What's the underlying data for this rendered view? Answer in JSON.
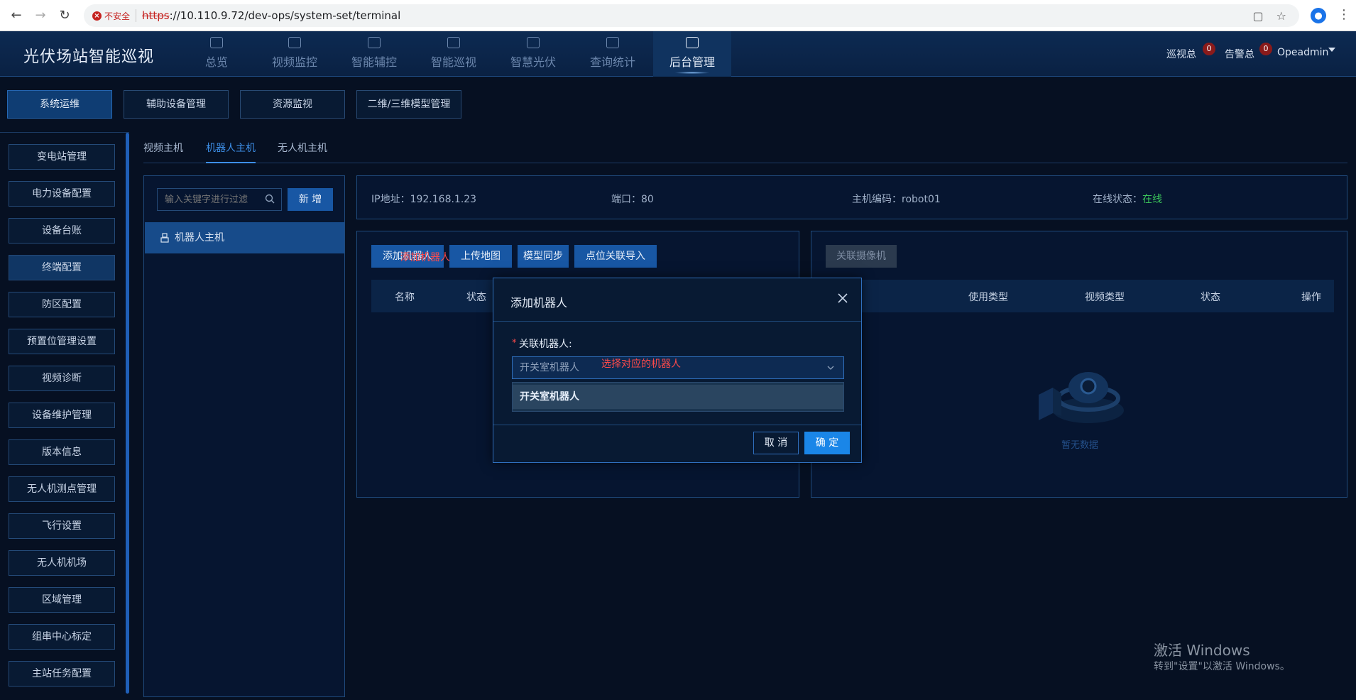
{
  "browser": {
    "insecure_label": "不安全",
    "url_scheme": "https",
    "url_rest": "://10.110.9.72/dev-ops/system-set/terminal"
  },
  "header": {
    "app_title": "光伏场站智能巡视",
    "nav": [
      {
        "label": "总览",
        "icon": "home-icon"
      },
      {
        "label": "视频监控",
        "icon": "video-icon"
      },
      {
        "label": "智能辅控",
        "icon": "document-icon"
      },
      {
        "label": "智能巡视",
        "icon": "monitor-icon"
      },
      {
        "label": "智慧光伏",
        "icon": "user-icon"
      },
      {
        "label": "查询统计",
        "icon": "report-icon"
      },
      {
        "label": "后台管理",
        "icon": "book-icon"
      }
    ],
    "patrol_label": "巡视总",
    "patrol_count": "0",
    "alarm_label": "告警总",
    "alarm_count": "0",
    "user": "Opeadmin"
  },
  "subtabs": [
    "系统运维",
    "辅助设备管理",
    "资源监视",
    "二维/三维模型管理"
  ],
  "menu": [
    "变电站管理",
    "电力设备配置",
    "设备台账",
    "终端配置",
    "防区配置",
    "预置位管理设置",
    "视频诊断",
    "设备维护管理",
    "版本信息",
    "无人机测点管理",
    "飞行设置",
    "无人机机场",
    "区域管理",
    "组串中心标定",
    "主站任务配置"
  ],
  "content_tabs": [
    "视频主机",
    "机器人主机",
    "无人机主机"
  ],
  "host_panel": {
    "search_placeholder": "输入关键字进行过滤",
    "add_label": "新 增",
    "host_item": "机器人主机"
  },
  "info": {
    "ip_label": "IP地址：",
    "ip_value": "192.168.1.23",
    "port_label": "端口：",
    "port_value": "80",
    "code_label": "主机编码：",
    "code_value": "robot01",
    "status_label": "在线状态：",
    "status_value": "在线"
  },
  "robot_panel": {
    "buttons": [
      "添加机器人",
      "上传地图",
      "模型同步",
      "点位关联导入"
    ],
    "annotation": "添加机器人",
    "columns": [
      "名称",
      "状态"
    ]
  },
  "cam_panel": {
    "button": "关联摄像机",
    "columns": [
      "使用类型",
      "视频类型",
      "状态",
      "操作"
    ],
    "empty_text": "暂无数据"
  },
  "modal": {
    "title": "添加机器人",
    "field_label": "关联机器人:",
    "select_value": "开关室机器人",
    "annotation": "选择对应的机器人",
    "option": "开关室机器人",
    "cancel": "取 消",
    "ok": "确 定"
  },
  "watermark": {
    "title": "激活 Windows",
    "subtitle": "转到\"设置\"以激活 Windows。"
  }
}
